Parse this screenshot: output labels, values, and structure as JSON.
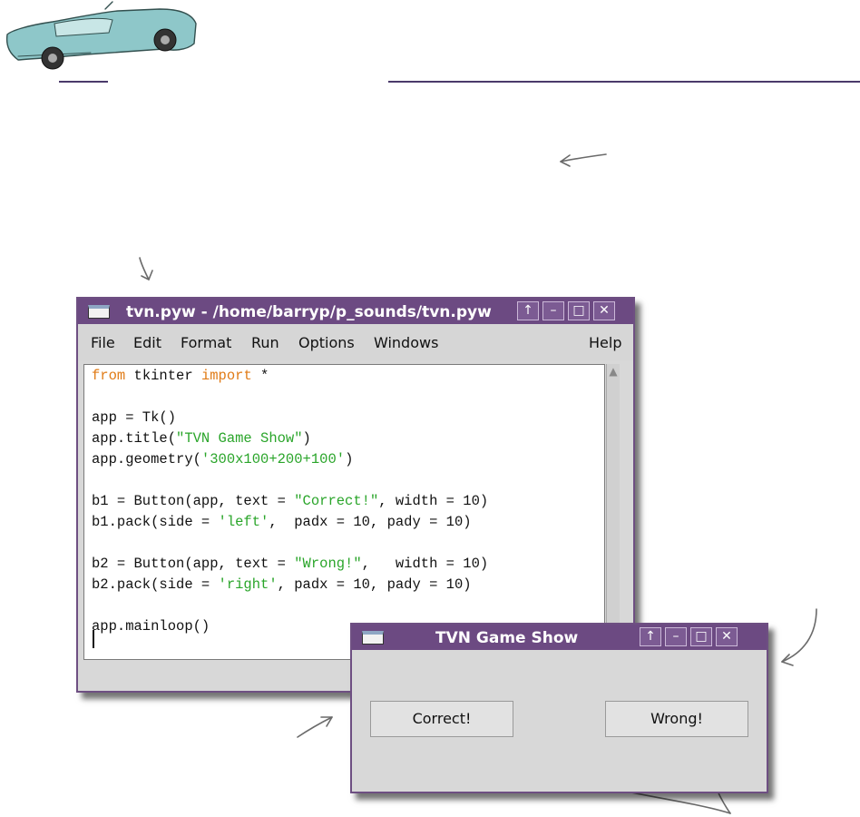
{
  "editor_window": {
    "title": "tvn.pyw - /home/barryp/p_sounds/tvn.pyw",
    "buttons": {
      "up": "↑",
      "minimize": "–",
      "maximize": "□",
      "close": "✕"
    },
    "menu": [
      "File",
      "Edit",
      "Format",
      "Run",
      "Options",
      "Windows"
    ],
    "help": "Help",
    "code": {
      "l1_kw1": "from",
      "l1_mid": " tkinter ",
      "l1_kw2": "import",
      "l1_end": " *",
      "l3": "app = Tk()",
      "l4_a": "app.title(",
      "l4_s": "\"TVN Game Show\"",
      "l4_b": ")",
      "l5_a": "app.geometry(",
      "l5_s": "'300x100+200+100'",
      "l5_b": ")",
      "l7_a": "b1 = Button(app, text = ",
      "l7_s": "\"Correct!\"",
      "l7_b": ", width = 10)",
      "l8_a": "b1.pack(side = ",
      "l8_s": "'left'",
      "l8_b": ",  padx = 10, pady = 10)",
      "l10_a": "b2 = Button(app, text = ",
      "l10_s": "\"Wrong!\"",
      "l10_b": ",   width = 10)",
      "l11_a": "b2.pack(side = ",
      "l11_s": "'right'",
      "l11_b": ", padx = 10, pady = 10)",
      "l13": "app.mainloop()"
    }
  },
  "app_window": {
    "title": "TVN Game Show",
    "buttons": {
      "up": "↑",
      "minimize": "–",
      "maximize": "□",
      "close": "✕"
    },
    "correct_label": "Correct!",
    "wrong_label": "Wrong!"
  },
  "colors": {
    "titlebar": "#6c4a82",
    "keyword": "#e07b16",
    "string": "#2aa52a"
  }
}
